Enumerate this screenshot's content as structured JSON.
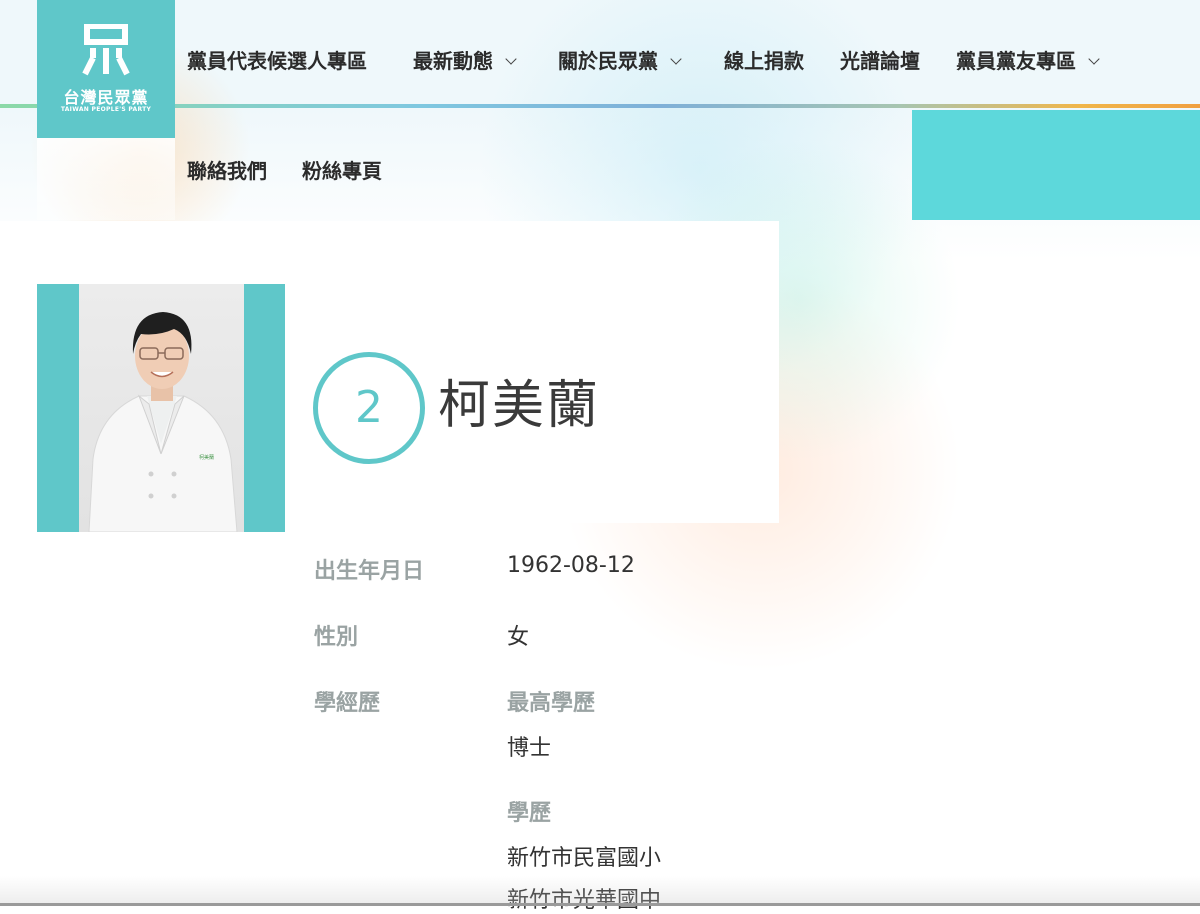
{
  "logo": {
    "name_cn": "台灣民眾黨",
    "name_en": "TAIWAN PEOPLE'S PARTY",
    "icon": "party-logo-icon"
  },
  "nav": {
    "items": [
      {
        "label": "黨員代表候選人專區",
        "has_dropdown": false
      },
      {
        "label": "最新動態",
        "has_dropdown": true
      },
      {
        "label": "關於民眾黨",
        "has_dropdown": true
      },
      {
        "label": "線上捐款",
        "has_dropdown": false
      },
      {
        "label": "光譜論壇",
        "has_dropdown": false
      },
      {
        "label": "黨員黨友專區",
        "has_dropdown": true
      },
      {
        "label": "聯絡我們",
        "has_dropdown": false
      },
      {
        "label": "粉絲專頁",
        "has_dropdown": false
      }
    ]
  },
  "candidate": {
    "number": "2",
    "name": "柯美蘭",
    "photo_badge": "柯美蘭"
  },
  "info": {
    "birth_label": "出生年月日",
    "birth_value": "1962-08-12",
    "gender_label": "性別",
    "gender_value": "女",
    "edu_label": "學經歷",
    "highest_edu_label": "最高學歷",
    "highest_edu_value": "博士",
    "edu_history_label": "學歷",
    "edu_history": [
      "新竹市民富國小",
      "新竹市光華國中"
    ]
  },
  "colors": {
    "brand_teal": "#5fc7c9",
    "accent_teal": "#5dd8db",
    "label_gray": "#9aa3a3"
  }
}
